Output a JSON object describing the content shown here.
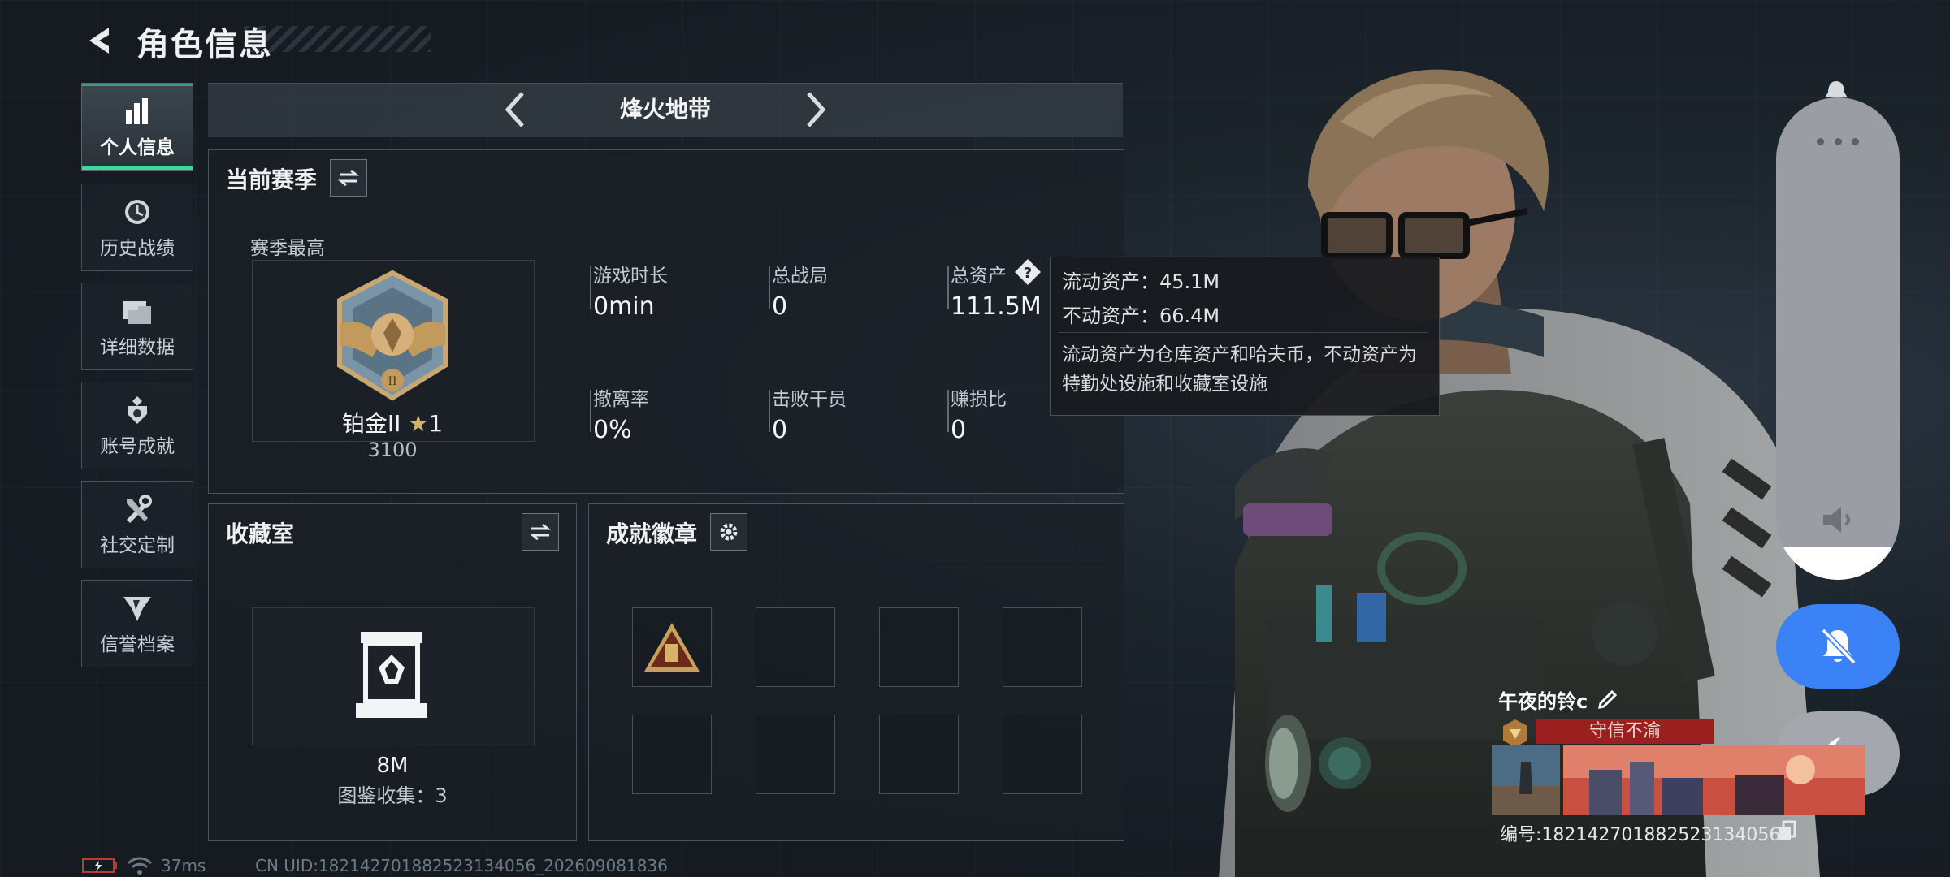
{
  "header": {
    "title": "角色信息"
  },
  "nav": {
    "items": [
      {
        "label": "个人信息",
        "icon": "bar-chart-icon",
        "active": true
      },
      {
        "label": "历史战绩",
        "icon": "clock-history-icon",
        "active": false
      },
      {
        "label": "详细数据",
        "icon": "folders-icon",
        "active": false
      },
      {
        "label": "账号成就",
        "icon": "achievement-icon",
        "active": false
      },
      {
        "label": "社交定制",
        "icon": "tools-icon",
        "active": false
      },
      {
        "label": "信誉档案",
        "icon": "reputation-icon",
        "active": false
      }
    ]
  },
  "mode": {
    "label": "烽火地带"
  },
  "season": {
    "title": "当前赛季",
    "best_label": "赛季最高",
    "rank_name": "铂金II",
    "rank_stars": "1",
    "rank_points": "3100",
    "stats": [
      {
        "label": "游戏时长",
        "value": "0min"
      },
      {
        "label": "总战局",
        "value": "0"
      },
      {
        "label": "总资产",
        "value": "111.5M"
      },
      {
        "label": "撤离率",
        "value": "0%"
      },
      {
        "label": "击败干员",
        "value": "0"
      },
      {
        "label": "赚损比",
        "value": "0"
      }
    ]
  },
  "tooltip": {
    "liquid": "流动资产：45.1M",
    "fixed": "不动资产：66.4M",
    "note": "流动资产为仓库资产和哈夫币，不动资产为特勤处设施和收藏室设施"
  },
  "collection": {
    "title": "收藏室",
    "value": "8M",
    "count": "图鉴收集：3"
  },
  "achievements": {
    "title": "成就徽章",
    "slots": [
      true,
      false,
      false,
      false,
      false,
      false,
      false,
      false
    ]
  },
  "player": {
    "name": "午夜的铃c",
    "badge_title": "守信不渝",
    "id_text": "编号:182142701882523134056"
  },
  "status": {
    "ping": "37ms",
    "uid": "CN UID:182142701882523134056_202609081836"
  },
  "colors": {
    "accent": "#3dd9a1",
    "mute_button": "#3b82f6",
    "badge_red": "#9b1f1f"
  }
}
